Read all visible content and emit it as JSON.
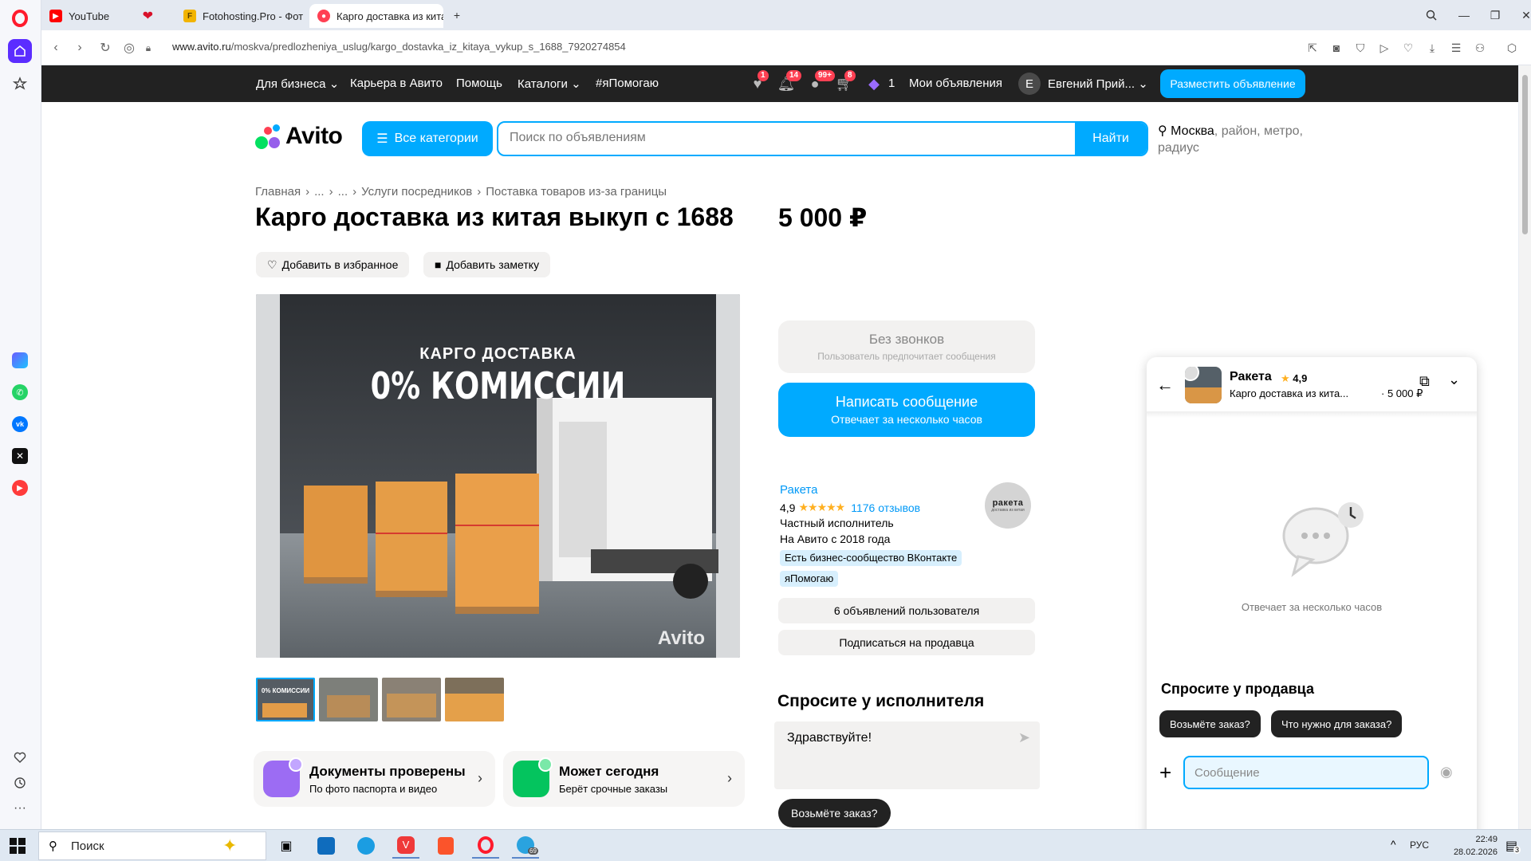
{
  "browser": {
    "tabs": [
      {
        "title": "YouTube",
        "active": false
      },
      {
        "title": "Fotohosting.Pro - Фотох",
        "active": false
      },
      {
        "title": "Карго доставка из китая",
        "active": true
      }
    ],
    "url_host": "www.avito.ru",
    "url_path": "/moskva/predlozheniya_uslug/kargo_dostavka_iz_kitaya_vykup_s_1688_7920274854"
  },
  "topnav": {
    "items": [
      "Для бизнеса",
      "Карьера в Авито",
      "Помощь",
      "Каталоги",
      "#яПомогаю"
    ],
    "badges": {
      "favorites": "1",
      "notifications": "14",
      "messages": "99+",
      "cart": "8"
    },
    "bonus_count": "1",
    "my_ads": "Мои объявления",
    "user_initial": "Е",
    "user_name": "Евгений Прий...",
    "post_button": "Разместить объявление"
  },
  "header": {
    "logo_text": "Avito",
    "all_categories": "Все категории",
    "search_placeholder": "Поиск по объявлениям",
    "find_button": "Найти",
    "location_city": "Москва",
    "location_rest": ", район, метро, радиус"
  },
  "listing": {
    "breadcrumb": [
      "Главная",
      "›",
      "...",
      "›",
      "...",
      "›",
      "Услуги посредников",
      "›",
      "Поставка товаров из-за границы"
    ],
    "title": "Карго доставка из китая выкуп с 1688",
    "price": "5 000 ₽",
    "add_favorite": "Добавить в избранное",
    "add_note": "Добавить заметку",
    "photo_line1": "КАРГО ДОСТАВКА",
    "photo_line2": "0% КОМИССИИ",
    "photo_watermark": "Avito",
    "thumb_caption": "0% КОМИССИИ"
  },
  "features": [
    {
      "title": "Документы проверены",
      "subtitle": "По фото паспорта и видео"
    },
    {
      "title": "Может сегодня",
      "subtitle": "Берёт срочные заказы"
    }
  ],
  "contact": {
    "no_calls_title": "Без звонков",
    "no_calls_sub": "Пользователь предпочитает сообщения",
    "write_title": "Написать сообщение",
    "write_sub": "Отвечает за несколько часов"
  },
  "seller": {
    "name": "Ракета",
    "rating": "4,9",
    "stars": "★★★★★",
    "reviews": "1176 отзывов",
    "type": "Частный исполнитель",
    "since": "На Авито с 2018 года",
    "tags": [
      "Есть бизнес-сообщество ВКонтакте",
      "яПомогаю"
    ],
    "avatar_name": "ракета",
    "avatar_slogan": "доставка из китая",
    "all_ads": "6 объявлений пользователя",
    "subscribe": "Подписаться на продавца"
  },
  "ask": {
    "title": "Спросите у исполнителя",
    "draft": "Здравствуйте!",
    "chip": "Возьмёте заказ?"
  },
  "chat": {
    "seller": "Ракета",
    "rating": "4,9",
    "item": "Карго доставка из кита...",
    "item_price": "· 5 000 ₽",
    "reply_time": "Отвечает за несколько часов",
    "ask_title": "Спросите у продавца",
    "chips": [
      "Возьмёте заказ?",
      "Что нужно для заказа?"
    ],
    "message_placeholder": "Сообщение"
  },
  "taskbar": {
    "search": "Поиск",
    "lang": "РУС",
    "time": "22:49",
    "date": "28.02.2026",
    "notif_count": "3",
    "telegram_badge": "69"
  },
  "colors": {
    "accent": "#00aaff",
    "dark": "#222222",
    "badge": "#ff4053"
  }
}
